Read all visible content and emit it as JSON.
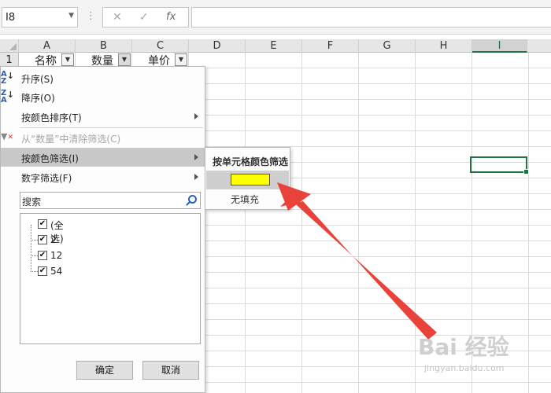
{
  "formula_bar": {
    "name_box": "I8",
    "dots": "⋮",
    "cancel": "✕",
    "enter": "✓",
    "fx": "fx",
    "content": ""
  },
  "columns": [
    "A",
    "B",
    "C",
    "D",
    "E",
    "F",
    "G",
    "H",
    "I"
  ],
  "selected_column": "I",
  "selected_cell": "I8",
  "rows": [
    "1"
  ],
  "row1": {
    "a": "名称",
    "b": "数量",
    "c": "单价"
  },
  "filter_menu": {
    "items": [
      {
        "label": "升序(S)",
        "icon": "sort-ascending-icon"
      },
      {
        "label": "降序(O)",
        "icon": "sort-descending-icon"
      },
      {
        "label": "按颜色排序(T)",
        "submenu": true
      },
      {
        "label": "从“数量”中清除筛选(C)",
        "disabled": true,
        "icon": "clear-filter-icon"
      },
      {
        "label": "按颜色筛选(I)",
        "submenu": true,
        "highlighted": true
      },
      {
        "label": "数字筛选(F)",
        "submenu": true
      }
    ],
    "search_placeholder": "搜索",
    "values": [
      {
        "label": "(全选)",
        "checked": true
      },
      {
        "label": "2",
        "checked": true
      },
      {
        "label": "12",
        "checked": true
      },
      {
        "label": "54",
        "checked": true
      }
    ],
    "ok_label": "确定",
    "cancel_label": "取消"
  },
  "color_submenu": {
    "title": "按单元格颜色筛选",
    "swatch_color": "#ffff00",
    "no_fill_label": "无填充"
  },
  "annotation": {
    "arrow_color": "#e8423a"
  },
  "watermark": {
    "brand": "Bai 经验",
    "url": "jingyan.baidu.com"
  }
}
